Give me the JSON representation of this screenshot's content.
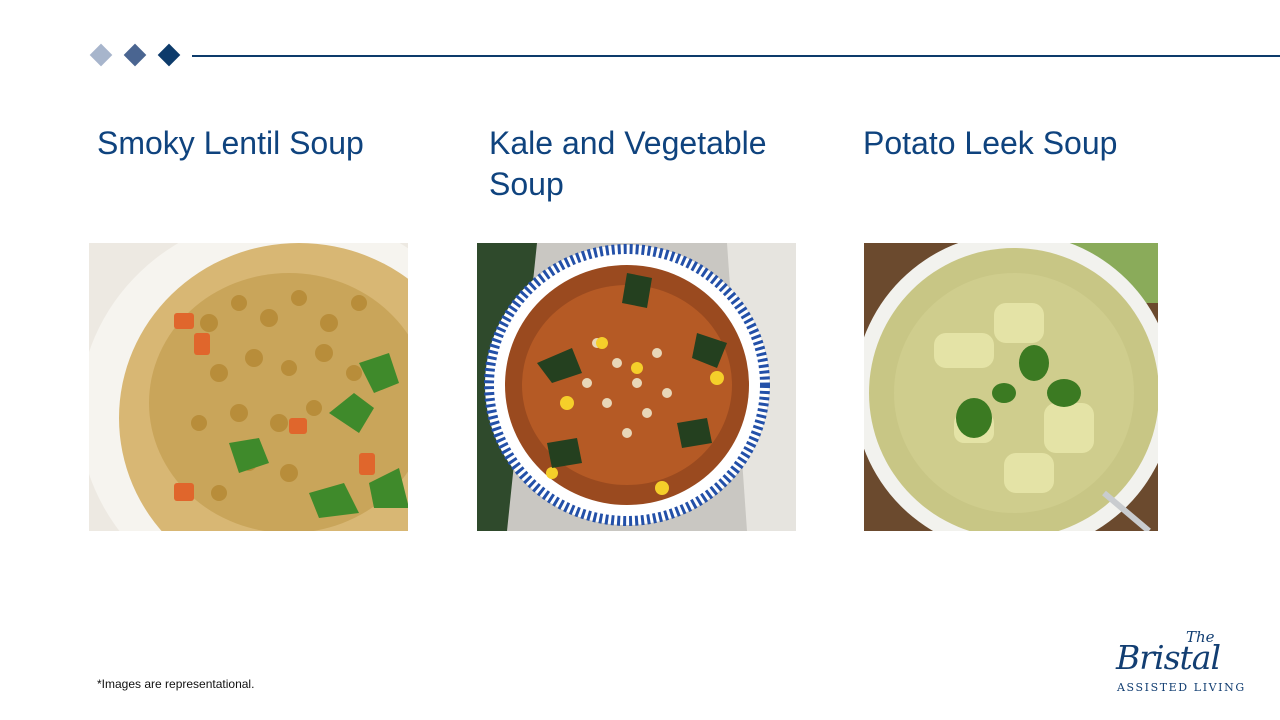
{
  "slide": {
    "recipes": [
      {
        "title": "Smoky Lentil Soup",
        "image_label": "smoky-lentil-soup-photo"
      },
      {
        "title": "Kale and Vegetable Soup",
        "image_label": "kale-vegetable-soup-photo"
      },
      {
        "title": "Potato Leek Soup",
        "image_label": "potato-leek-soup-photo"
      }
    ],
    "footnote": "*Images are representational.",
    "logo": {
      "the": "The",
      "name": "Bristal",
      "subtitle": "ASSISTED LIVING"
    }
  },
  "colors": {
    "accent": "#0d3b6b",
    "title": "#0f437e",
    "diamond_light": "#a7b5cc",
    "diamond_mid": "#4a6591"
  }
}
